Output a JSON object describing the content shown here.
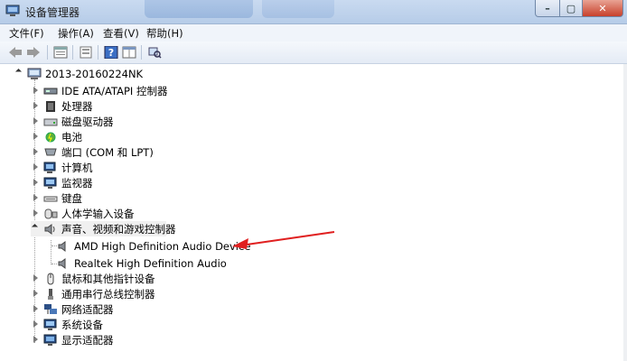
{
  "window": {
    "title": "设备管理器"
  },
  "menu": [
    "文件(F)",
    "操作(A)",
    "查看(V)",
    "帮助(H)"
  ],
  "toolbar": {
    "icons": [
      "back-arrow-icon",
      "forward-arrow-icon",
      "properties-icon",
      "show-hide-icon",
      "help-icon",
      "grid-icon",
      "scan-hardware-icon"
    ]
  },
  "tree": {
    "root": "2013-20160224NK",
    "items": [
      {
        "label": "IDE ATA/ATAPI 控制器",
        "icon": "ide-controller-icon",
        "state": "collapsed"
      },
      {
        "label": "处理器",
        "icon": "processor-icon",
        "state": "collapsed"
      },
      {
        "label": "磁盘驱动器",
        "icon": "disk-drive-icon",
        "state": "collapsed"
      },
      {
        "label": "电池",
        "icon": "battery-icon",
        "state": "collapsed"
      },
      {
        "label": "端口 (COM 和 LPT)",
        "icon": "port-icon",
        "state": "collapsed"
      },
      {
        "label": "计算机",
        "icon": "computer-icon",
        "state": "collapsed"
      },
      {
        "label": "监视器",
        "icon": "monitor-icon",
        "state": "collapsed"
      },
      {
        "label": "键盘",
        "icon": "keyboard-icon",
        "state": "collapsed"
      },
      {
        "label": "人体学输入设备",
        "icon": "hid-icon",
        "state": "collapsed"
      },
      {
        "label": "声音、视频和游戏控制器",
        "icon": "sound-icon",
        "state": "expanded",
        "children": [
          {
            "label": "AMD High Definition Audio Device",
            "icon": "speaker-icon"
          },
          {
            "label": "Realtek High Definition Audio",
            "icon": "speaker-icon"
          }
        ]
      },
      {
        "label": "鼠标和其他指针设备",
        "icon": "mouse-icon",
        "state": "collapsed"
      },
      {
        "label": "通用串行总线控制器",
        "icon": "usb-icon",
        "state": "collapsed"
      },
      {
        "label": "网络适配器",
        "icon": "network-icon",
        "state": "collapsed"
      },
      {
        "label": "系统设备",
        "icon": "system-icon",
        "state": "collapsed"
      },
      {
        "label": "显示适配器",
        "icon": "display-adapter-icon",
        "state": "collapsed"
      }
    ]
  },
  "annotation": {
    "color": "#e02020"
  }
}
